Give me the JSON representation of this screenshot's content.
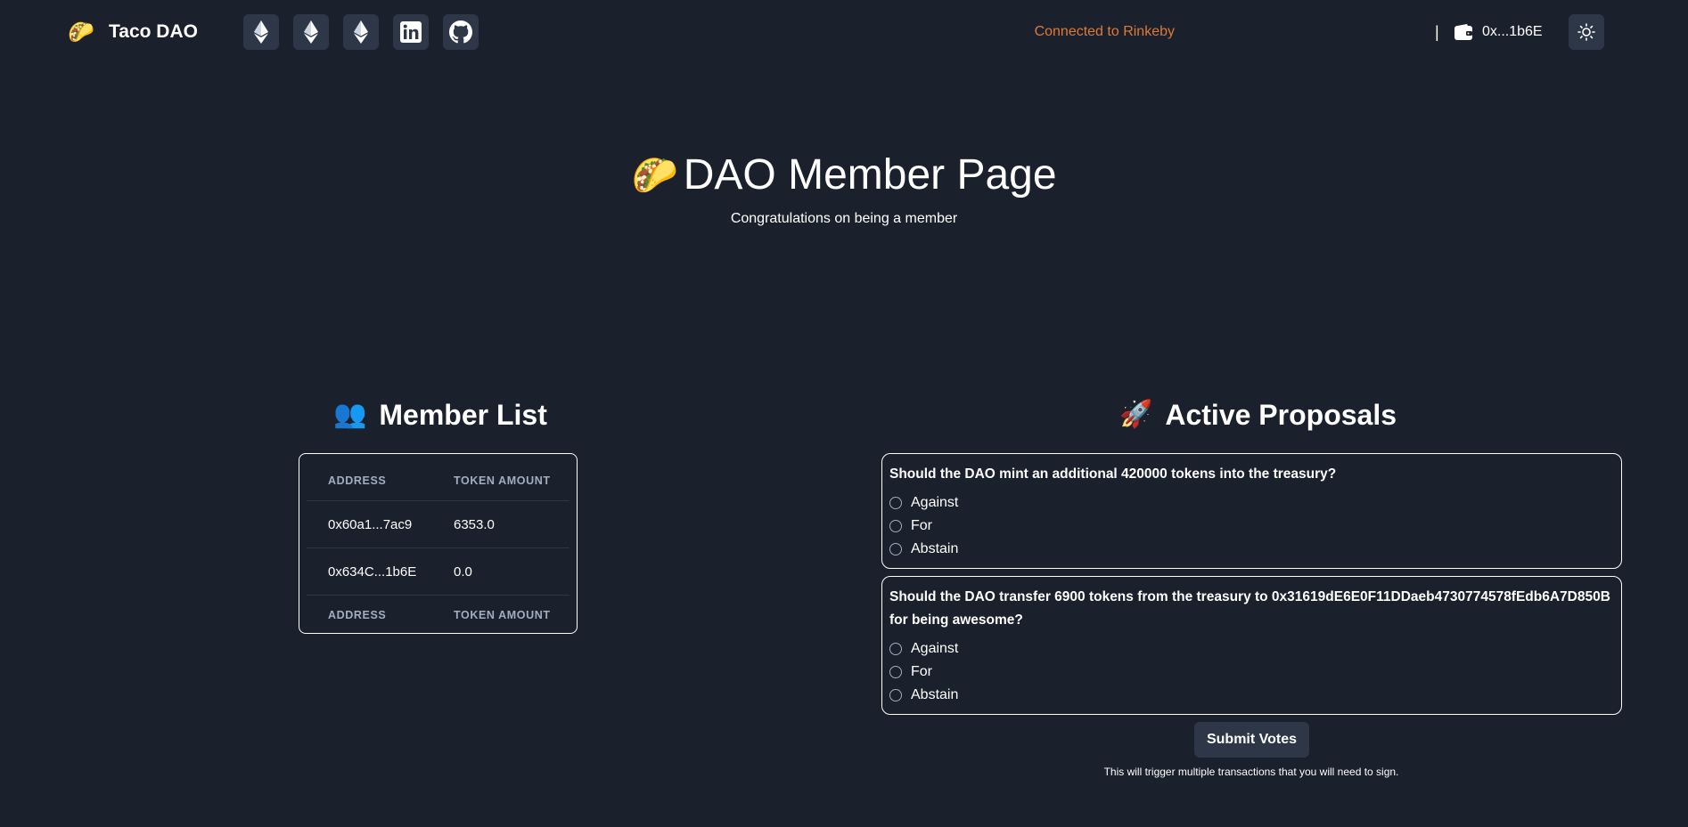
{
  "nav": {
    "brand_emoji": "🌮",
    "brand_name": "Taco DAO",
    "icons": [
      "ethereum-icon",
      "ethereum-icon",
      "ethereum-icon",
      "linkedin-icon",
      "github-icon"
    ],
    "network_status": "Connected to Rinkeby",
    "separator": "|",
    "wallet_address": "0x...1b6E",
    "theme_icon": "sun-icon"
  },
  "hero": {
    "emoji": "🌮",
    "title": "DAO Member Page",
    "subtitle": "Congratulations on being a member"
  },
  "members": {
    "emoji": "👥",
    "title": "Member List",
    "headers": [
      "ADDRESS",
      "TOKEN AMOUNT"
    ],
    "rows": [
      {
        "address": "0x60a1...7ac9",
        "amount": "6353.0"
      },
      {
        "address": "0x634C...1b6E",
        "amount": "0.0"
      }
    ],
    "footers": [
      "ADDRESS",
      "TOKEN AMOUNT"
    ]
  },
  "proposals": {
    "emoji": "🚀",
    "title": "Active Proposals",
    "items": [
      {
        "question": "Should the DAO mint an additional 420000 tokens into the treasury?",
        "options": [
          "Against",
          "For",
          "Abstain"
        ]
      },
      {
        "question": "Should the DAO transfer 6900 tokens from the treasury to 0x31619dE6E0F11DDaeb4730774578fEdb6A7D850B for being awesome?",
        "options": [
          "Against",
          "For",
          "Abstain"
        ]
      }
    ],
    "submit_label": "Submit Votes",
    "note": "This will trigger multiple transactions that you will need to sign."
  },
  "colors": {
    "background": "#1a202c",
    "button_bg": "#2d3748",
    "network_status": "#dd7a3a",
    "muted_header": "#a0aec0"
  }
}
